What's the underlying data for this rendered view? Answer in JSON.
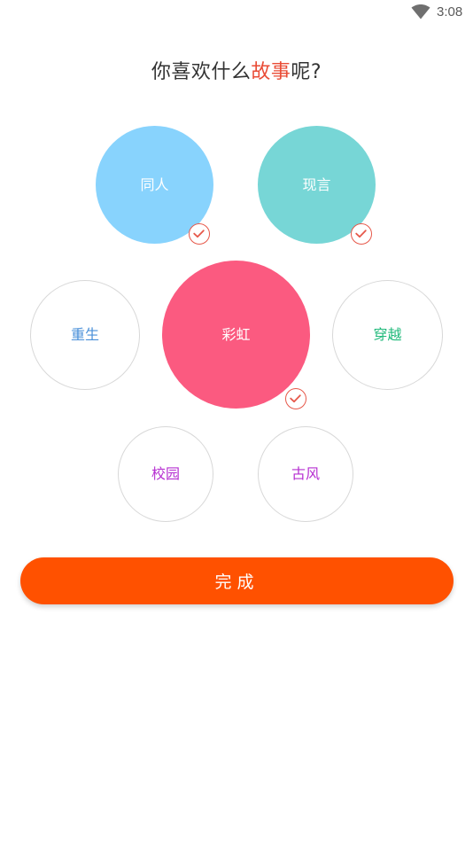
{
  "status_bar": {
    "time": "3:08",
    "wifi_icon": "wifi-icon"
  },
  "title": {
    "prefix": "你喜欢什么",
    "highlight": "故事",
    "suffix": "呢?",
    "highlight_color": "#e94b35"
  },
  "genres": [
    {
      "label": "同人",
      "selected": true,
      "fill": "#88d3fd",
      "text_color": "#ffffff"
    },
    {
      "label": "现言",
      "selected": true,
      "fill": "#77d6d6",
      "text_color": "#ffffff"
    },
    {
      "label": "重生",
      "selected": false,
      "fill": "#ffffff",
      "text_color": "#4a90d9"
    },
    {
      "label": "彩虹",
      "selected": true,
      "fill": "#fb5a80",
      "text_color": "#ffffff"
    },
    {
      "label": "穿越",
      "selected": false,
      "fill": "#ffffff",
      "text_color": "#1fb97a"
    },
    {
      "label": "校园",
      "selected": false,
      "fill": "#ffffff",
      "text_color": "#b62fd1"
    },
    {
      "label": "古风",
      "selected": false,
      "fill": "#ffffff",
      "text_color": "#b62fd1"
    }
  ],
  "check_icon": "check-circle-icon",
  "check_color": "#e6584a",
  "done_button": {
    "label": "完成",
    "color": "#ff5100"
  }
}
